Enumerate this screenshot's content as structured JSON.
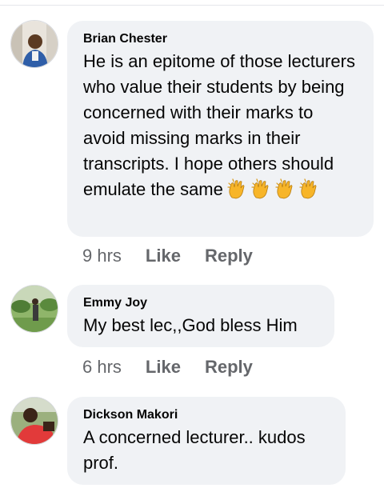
{
  "comments": [
    {
      "author": "Brian Chester",
      "text": "He is an epitome of those lecturers who value their students by being concerned with their marks to avoid missing marks in their transcripts. I hope others should emulate the same",
      "emoji": [
        "clapping-hands-icon",
        "clapping-hands-icon",
        "clapping-hands-icon",
        "clapping-hands-icon"
      ],
      "time": "9 hrs",
      "like_label": "Like",
      "reply_label": "Reply"
    },
    {
      "author": "Emmy Joy",
      "text": "My best lec,,God bless Him",
      "time": "6 hrs",
      "like_label": "Like",
      "reply_label": "Reply"
    },
    {
      "author": "Dickson Makori",
      "text": "A concerned lecturer.. kudos prof."
    }
  ],
  "colors": {
    "bubble": "#f0f2f5",
    "name": "#050505",
    "meta": "#65676b",
    "clap": "#f7b529"
  }
}
